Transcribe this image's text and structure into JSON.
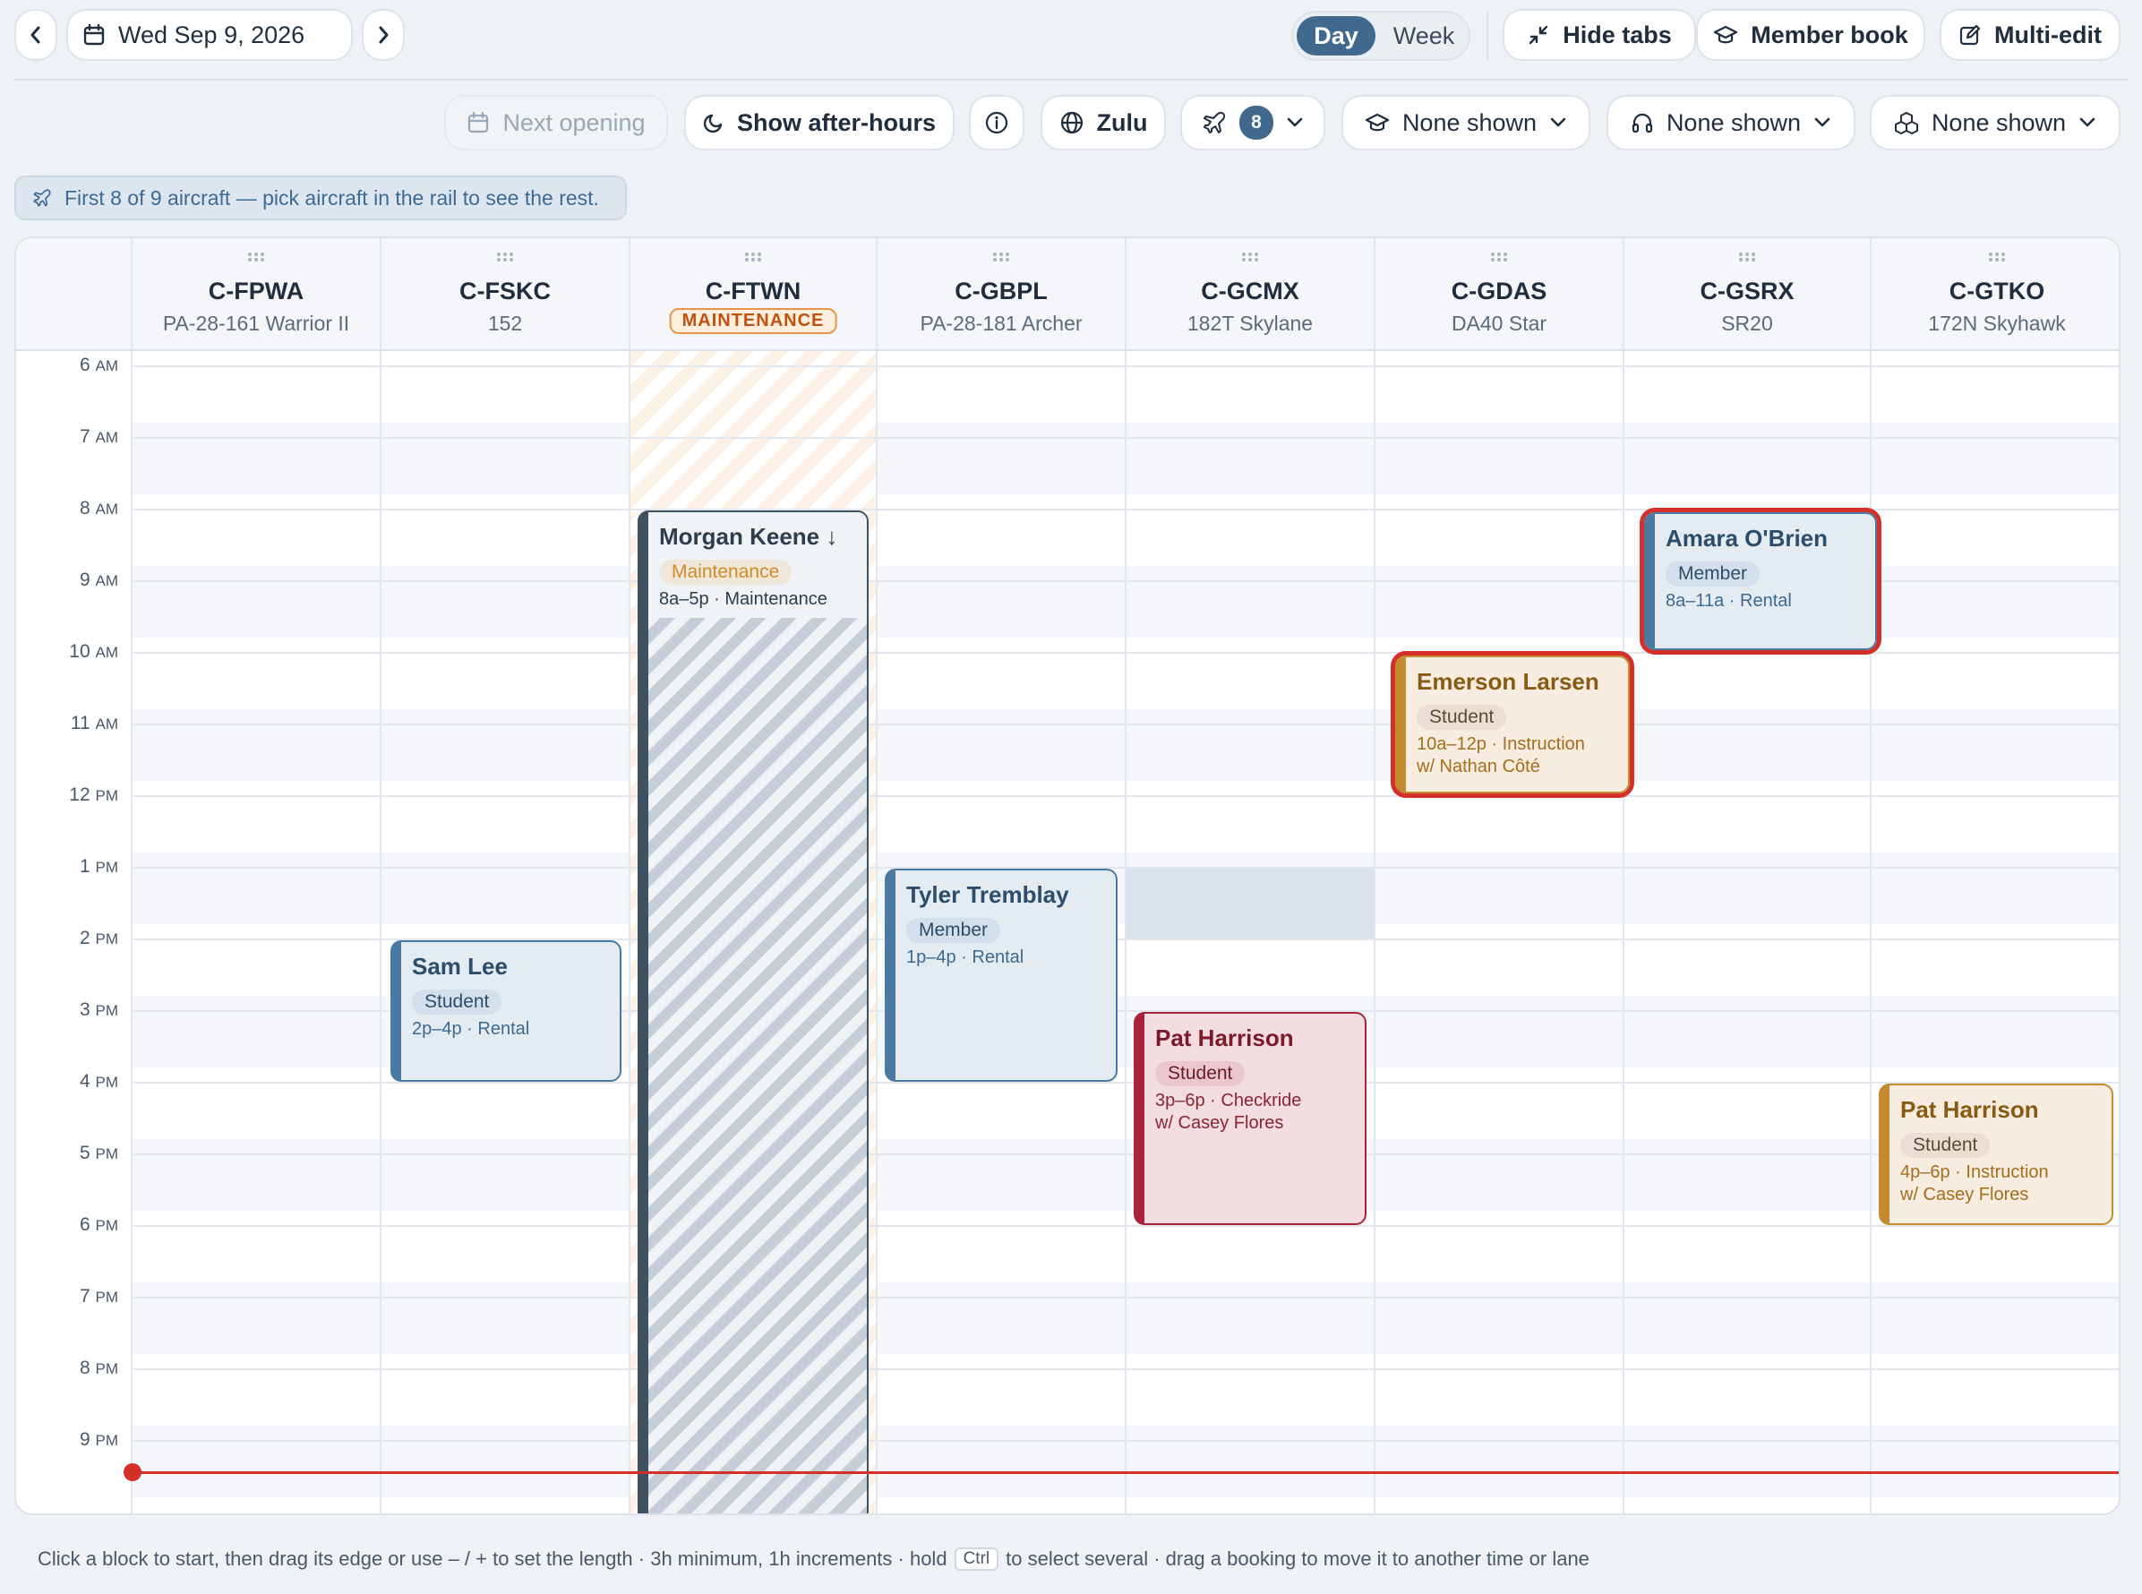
{
  "toolbar": {
    "date": "Wed Sep 9, 2026",
    "view_day": "Day",
    "view_week": "Week",
    "hide_tabs": "Hide tabs",
    "member_book": "Member book",
    "multi_edit": "Multi-edit"
  },
  "filters": {
    "next_opening": "Next opening",
    "after_hours": "Show after-hours",
    "timezone": "Zulu",
    "aircraft_count": "8",
    "instructors": "None shown",
    "headset": "None shown",
    "resources": "None shown"
  },
  "notice": "First 8 of 9 aircraft — pick aircraft in the rail to see the rest.",
  "aircraft": [
    {
      "reg": "C-FPWA",
      "model": "PA-28-161 Warrior II"
    },
    {
      "reg": "C-FSKC",
      "model": "152"
    },
    {
      "reg": "C-FTWN",
      "status": "MAINTENANCE"
    },
    {
      "reg": "C-GBPL",
      "model": "PA-28-181 Archer"
    },
    {
      "reg": "C-GCMX",
      "model": "182T Skylane"
    },
    {
      "reg": "C-GDAS",
      "model": "DA40 Star"
    },
    {
      "reg": "C-GSRX",
      "model": "SR20"
    },
    {
      "reg": "C-GTKO",
      "model": "172N Skyhawk"
    }
  ],
  "times": [
    {
      "h": "6",
      "p": "AM"
    },
    {
      "h": "7",
      "p": "AM"
    },
    {
      "h": "8",
      "p": "AM"
    },
    {
      "h": "9",
      "p": "AM"
    },
    {
      "h": "10",
      "p": "AM"
    },
    {
      "h": "11",
      "p": "AM"
    },
    {
      "h": "12",
      "p": "PM"
    },
    {
      "h": "1",
      "p": "PM"
    },
    {
      "h": "2",
      "p": "PM"
    },
    {
      "h": "3",
      "p": "PM"
    },
    {
      "h": "4",
      "p": "PM"
    },
    {
      "h": "5",
      "p": "PM"
    },
    {
      "h": "6",
      "p": "PM"
    },
    {
      "h": "7",
      "p": "PM"
    },
    {
      "h": "8",
      "p": "PM"
    },
    {
      "h": "9",
      "p": "PM"
    }
  ],
  "bookings": [
    {
      "name": "Morgan Keene ↓",
      "tag": "Maintenance",
      "line1": "8a–5p · Maintenance",
      "line2": ""
    },
    {
      "name": "Sam Lee",
      "tag": "Student",
      "line1": "2p–4p · Rental",
      "line2": ""
    },
    {
      "name": "Tyler Tremblay",
      "tag": "Member",
      "line1": "1p–4p · Rental",
      "line2": ""
    },
    {
      "name": "Pat Harrison",
      "tag": "Student",
      "line1": "3p–6p · Checkride",
      "line2": "w/ Casey Flores"
    },
    {
      "name": "Emerson Larsen",
      "tag": "Student",
      "line1": "10a–12p · Instruction",
      "line2": "w/ Nathan Côté"
    },
    {
      "name": "Amara O'Brien",
      "tag": "Member",
      "line1": "8a–11a · Rental",
      "line2": ""
    },
    {
      "name": "Pat Harrison",
      "tag": "Student",
      "line1": "4p–6p · Instruction",
      "line2": "w/ Casey Flores"
    }
  ],
  "footer": {
    "part1": "Click a block to start, then drag its edge or use – / + to set the length · 3h minimum, 1h increments · hold",
    "key": "Ctrl",
    "part2": "to select several · drag a booking to move it to another time or lane"
  }
}
